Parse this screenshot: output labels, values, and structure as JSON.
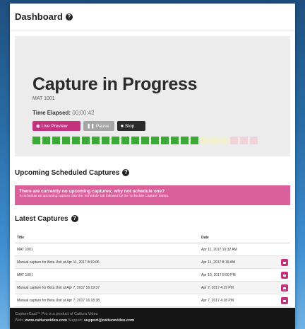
{
  "header": {
    "title": "Dashboard",
    "help_glyph": "?"
  },
  "capture": {
    "title": "Capture in Progress",
    "source": "MAT 1001",
    "elapsed_label": "Time Elapsed:",
    "elapsed_value": "00:00:42",
    "buttons": {
      "live_preview": "Live Preview",
      "pause": "Pause",
      "stop": "Stop"
    },
    "level_meter": {
      "green_segments": 17,
      "yellow_segments": 3,
      "red_segments": 3
    }
  },
  "upcoming": {
    "title": "Upcoming Scheduled Captures",
    "alert_main": "There are currently no upcoming captures; why not schedule one?",
    "alert_sub": "To schedule an upcoming capture click the 'Schedule' tab followed by the 'Schedule Capture' button."
  },
  "latest": {
    "title": "Latest Captures",
    "columns": [
      "Title",
      "Date"
    ],
    "rows": [
      {
        "title": "MAT 1001",
        "date": "Apr 11, 2017 10:32 AM",
        "download": false
      },
      {
        "title": "Manual capture for Beta Unit at Apr 11, 2017 8:19:06",
        "date": "Apr 11, 2017 8:19 AM",
        "download": true
      },
      {
        "title": "MAT 1001",
        "date": "Apr 10, 2017 8:00 PM",
        "download": true
      },
      {
        "title": "Manual capture for Beta Unit at Apr 7, 2017 16:19:37",
        "date": "Apr 7, 2017 4:19 PM",
        "download": true
      },
      {
        "title": "Manual capture for Beta Unit at Apr 7, 2017 16:18:38",
        "date": "Apr 7, 2017 4:18 PM",
        "download": true
      }
    ]
  },
  "footer": {
    "line1": "CaptureCast™ Pro is a product of Cattura Video",
    "web_label": "Web:",
    "web_value": "www.catturavideo.com",
    "support_label": "Support:",
    "support_value": "support@catturavideo.com"
  },
  "colors": {
    "accent_magenta": "#c2327e",
    "alert_pink": "#d9609a",
    "meter_green": "#3aaa35",
    "footer_bg": "#161616"
  }
}
